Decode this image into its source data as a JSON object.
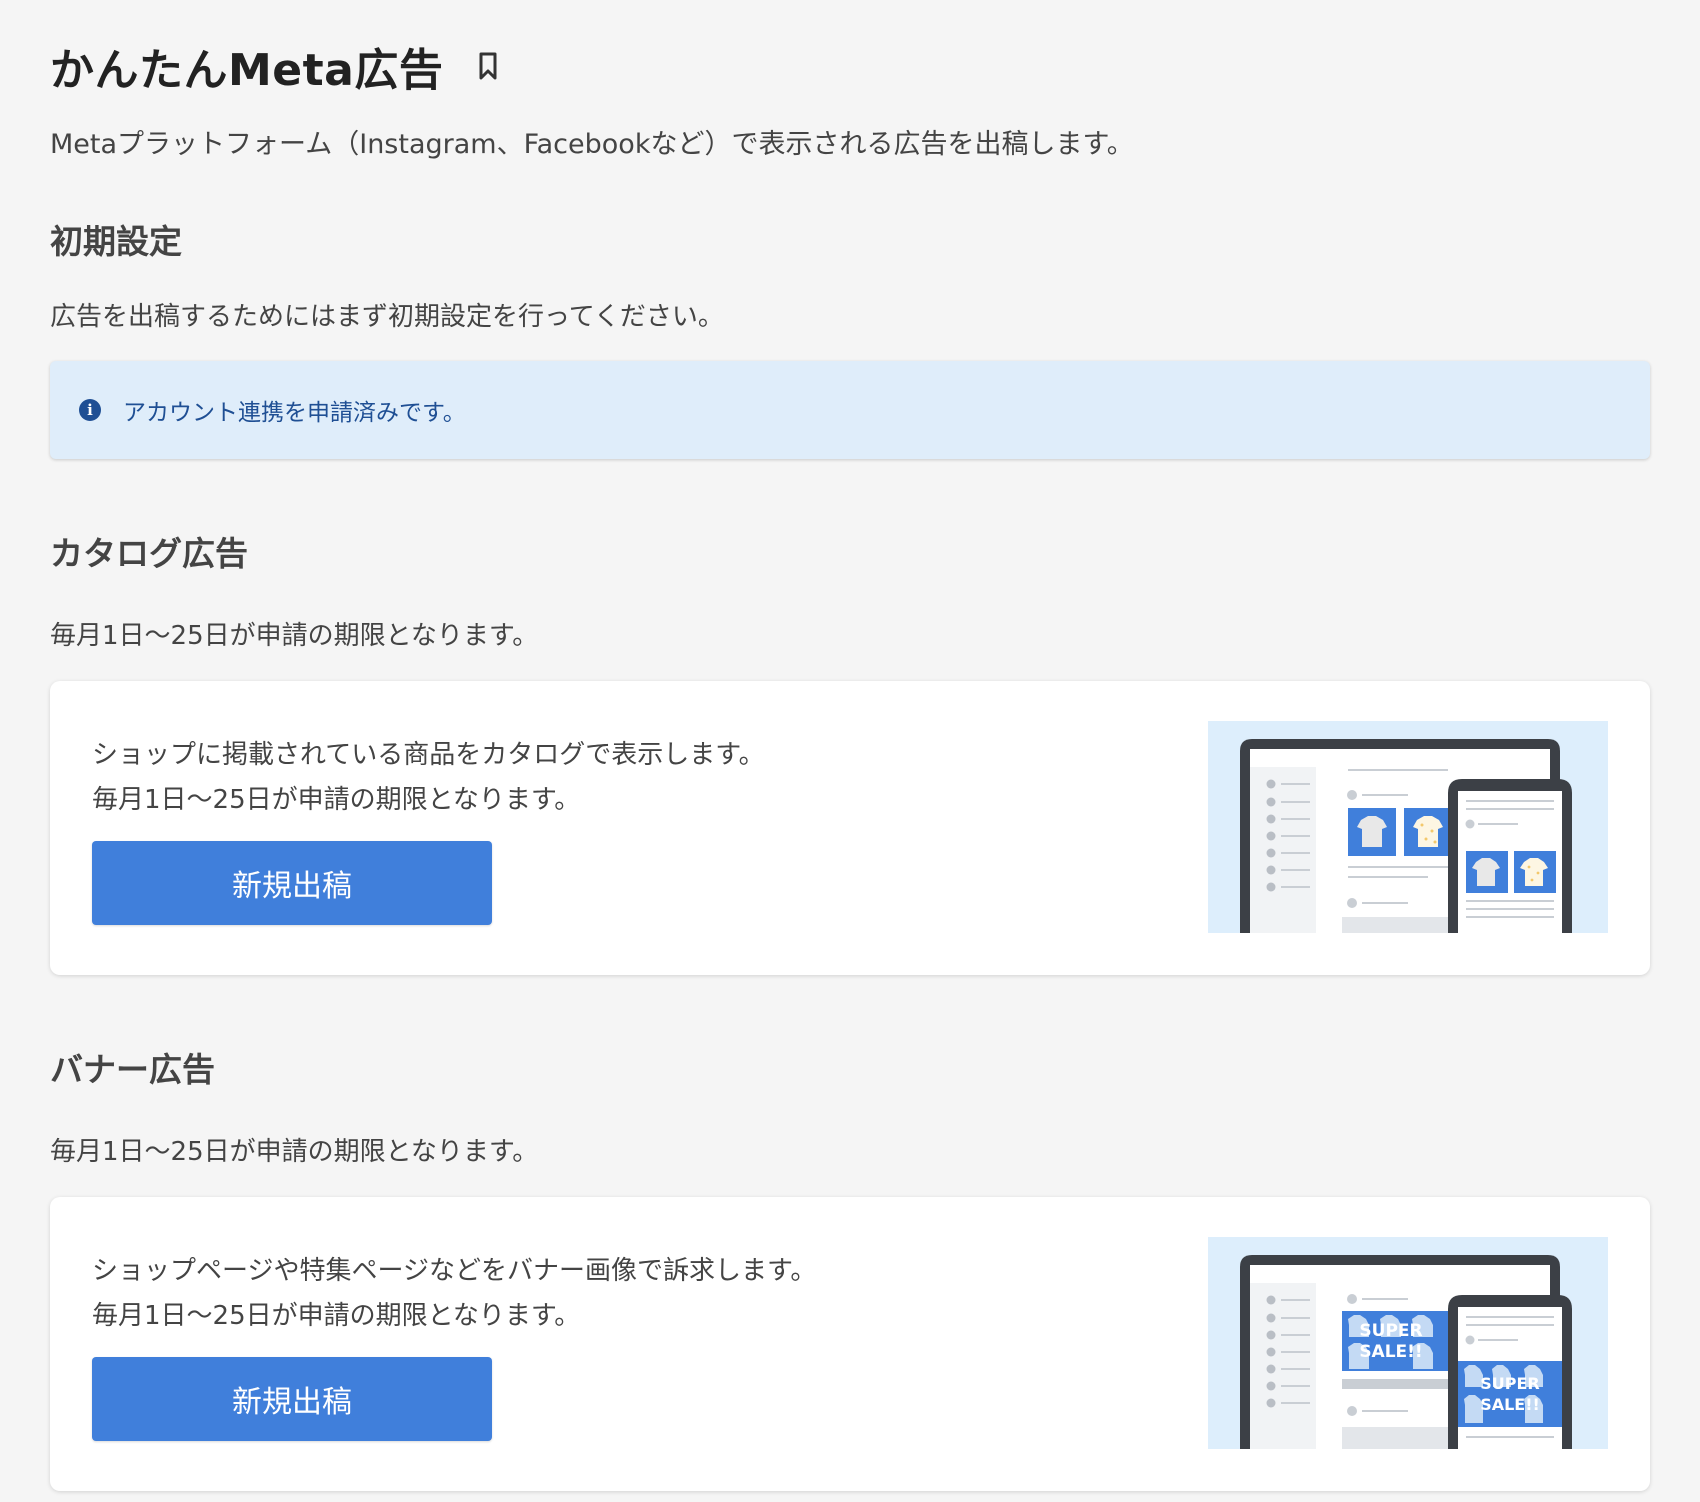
{
  "header": {
    "title": "かんたんMeta広告",
    "subtitle": "Metaプラットフォーム（Instagram、Facebookなど）で表示される広告を出稿します。"
  },
  "initial_setup": {
    "heading": "初期設定",
    "description": "広告を出稿するためにはまず初期設定を行ってください。",
    "info_message": "アカウント連携を申請済みです。"
  },
  "catalog": {
    "heading": "カタログ広告",
    "description": "毎月1日〜25日が申請の期限となります。",
    "card_line1": "ショップに掲載されている商品をカタログで表示します。",
    "card_line2": "毎月1日〜25日が申請の期限となります。",
    "button_label": "新規出稿"
  },
  "banner": {
    "heading": "バナー広告",
    "description": "毎月1日〜25日が申請の期限となります。",
    "card_line1": "ショップページや特集ページなどをバナー画像で訴求します。",
    "card_line2": "毎月1日〜25日が申請の期限となります。",
    "button_label": "新規出稿",
    "illustration_text_line1": "SUPER",
    "illustration_text_line2": "SALE!!"
  },
  "colors": {
    "background": "#f5f5f5",
    "info_bg": "#dfedfa",
    "info_text": "#1f4f94",
    "button": "#407fdb",
    "illustration_bg": "#ddeefc"
  },
  "icons": {
    "bookmark": "bookmark-icon",
    "info": "info-icon"
  }
}
